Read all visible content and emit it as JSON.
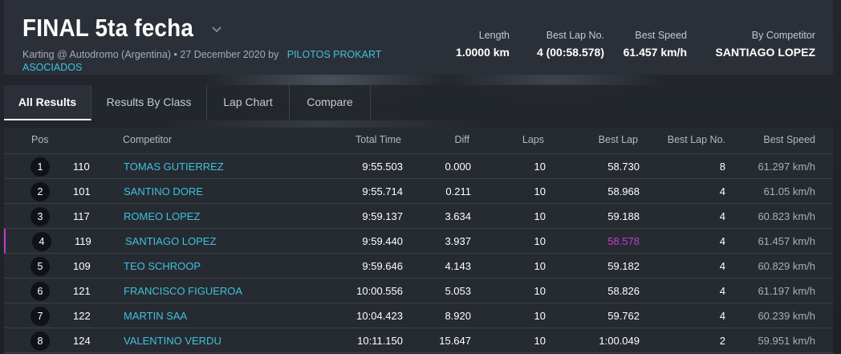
{
  "event": {
    "title": "FINAL 5ta fecha",
    "subtitle_prefix": "Karting @ Autodromo (Argentina) • 27 December 2020 by",
    "organizer": "PILOTOS PROKART ASOCIADOS"
  },
  "stats": {
    "length_label": "Length",
    "length_value": "1.0000 km",
    "best_lap_no_label": "Best Lap No.",
    "best_lap_no_value": "4 (00:58.578)",
    "best_speed_label": "Best Speed",
    "best_speed_value": "61.457 km/h",
    "by_competitor_label": "By Competitor",
    "by_competitor_value": "SANTIAGO LOPEZ"
  },
  "tabs": [
    "All Results",
    "Results By Class",
    "Lap Chart",
    "Compare"
  ],
  "columns": {
    "pos": "Pos",
    "competitor": "Competitor",
    "total_time": "Total Time",
    "diff": "Diff",
    "laps": "Laps",
    "best_lap": "Best Lap",
    "best_lap_no": "Best Lap No.",
    "best_speed": "Best Speed"
  },
  "rows": [
    {
      "pos": "1",
      "num": "110",
      "name": "TOMAS GUTIERREZ",
      "total": "9:55.503",
      "diff": "0.000",
      "laps": "10",
      "best": "58.730",
      "bestno": "8",
      "speed": "61.297 km/h"
    },
    {
      "pos": "2",
      "num": "101",
      "name": "SANTINO DORE",
      "total": "9:55.714",
      "diff": "0.211",
      "laps": "10",
      "best": "58.968",
      "bestno": "4",
      "speed": "61.05 km/h"
    },
    {
      "pos": "3",
      "num": "117",
      "name": "ROMEO LOPEZ",
      "total": "9:59.137",
      "diff": "3.634",
      "laps": "10",
      "best": "59.188",
      "bestno": "4",
      "speed": "60.823 km/h"
    },
    {
      "pos": "4",
      "num": "119",
      "name": "SANTIAGO LOPEZ",
      "total": "9:59.440",
      "diff": "3.937",
      "laps": "10",
      "best": "58.578",
      "bestno": "4",
      "speed": "61.457 km/h"
    },
    {
      "pos": "5",
      "num": "109",
      "name": "TEO SCHROOP",
      "total": "9:59.646",
      "diff": "4.143",
      "laps": "10",
      "best": "59.182",
      "bestno": "4",
      "speed": "60.829 km/h"
    },
    {
      "pos": "6",
      "num": "121",
      "name": "FRANCISCO FIGUEROA",
      "total": "10:00.556",
      "diff": "5.053",
      "laps": "10",
      "best": "58.826",
      "bestno": "4",
      "speed": "61.197 km/h"
    },
    {
      "pos": "7",
      "num": "122",
      "name": "MARTIN SAA",
      "total": "10:04.423",
      "diff": "8.920",
      "laps": "10",
      "best": "59.762",
      "bestno": "4",
      "speed": "60.239 km/h"
    },
    {
      "pos": "8",
      "num": "124",
      "name": "VALENTINO VERDU",
      "total": "10:11.150",
      "diff": "15.647",
      "laps": "10",
      "best": "1:00.049",
      "bestno": "2",
      "speed": "59.951 km/h"
    }
  ],
  "colors": {
    "accent": "#3fc1dd",
    "best_lap_highlight": "#c83acf",
    "background": "#1c2026",
    "panel": "#2b3038"
  }
}
